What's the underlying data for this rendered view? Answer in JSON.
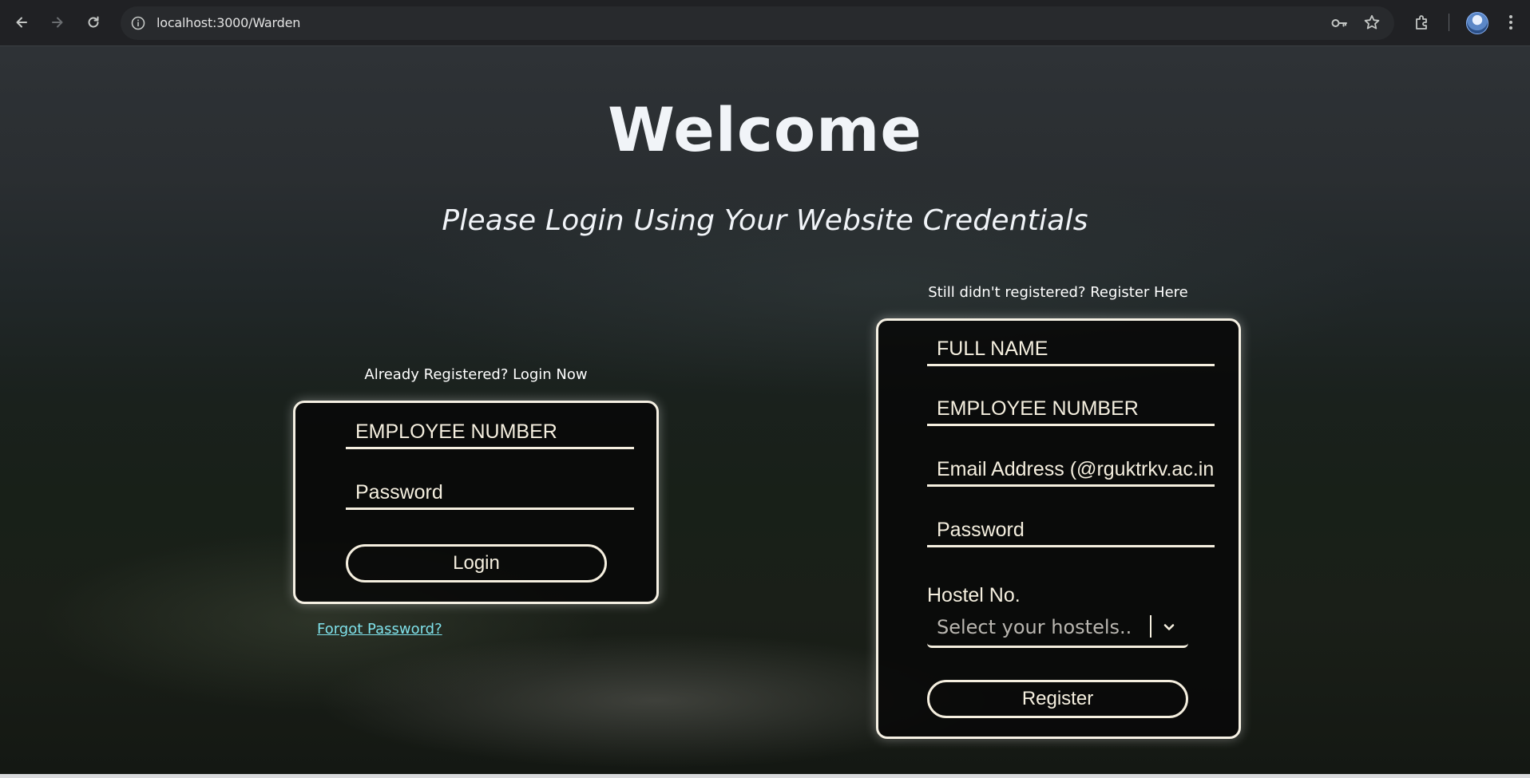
{
  "browser": {
    "url": "localhost:3000/Warden"
  },
  "page": {
    "title": "Welcome",
    "subtitle": "Please Login Using Your Website Credentials"
  },
  "login": {
    "caption": "Already Registered? Login Now",
    "employee_placeholder": "EMPLOYEE NUMBER",
    "password_placeholder": "Password",
    "button_label": "Login",
    "forgot_label": "Forgot Password?"
  },
  "register": {
    "caption": "Still didn't registered? Register Here",
    "fullname_placeholder": "FULL NAME",
    "employee_placeholder": "EMPLOYEE NUMBER",
    "email_placeholder": "Email Address (@rguktrkv.ac.in",
    "password_placeholder": "Password",
    "hostel_label": "Hostel No.",
    "hostel_select_placeholder": "Select your hostels..",
    "button_label": "Register"
  },
  "colors": {
    "card_border": "#f6f1e4",
    "link": "#7fe1ea",
    "chrome_bg": "#202124"
  },
  "icons": [
    "back-icon",
    "forward-icon",
    "reload-icon",
    "info-icon",
    "key-icon",
    "star-icon",
    "extensions-icon",
    "profile-avatar",
    "more-vert-icon",
    "chevron-down-icon"
  ]
}
